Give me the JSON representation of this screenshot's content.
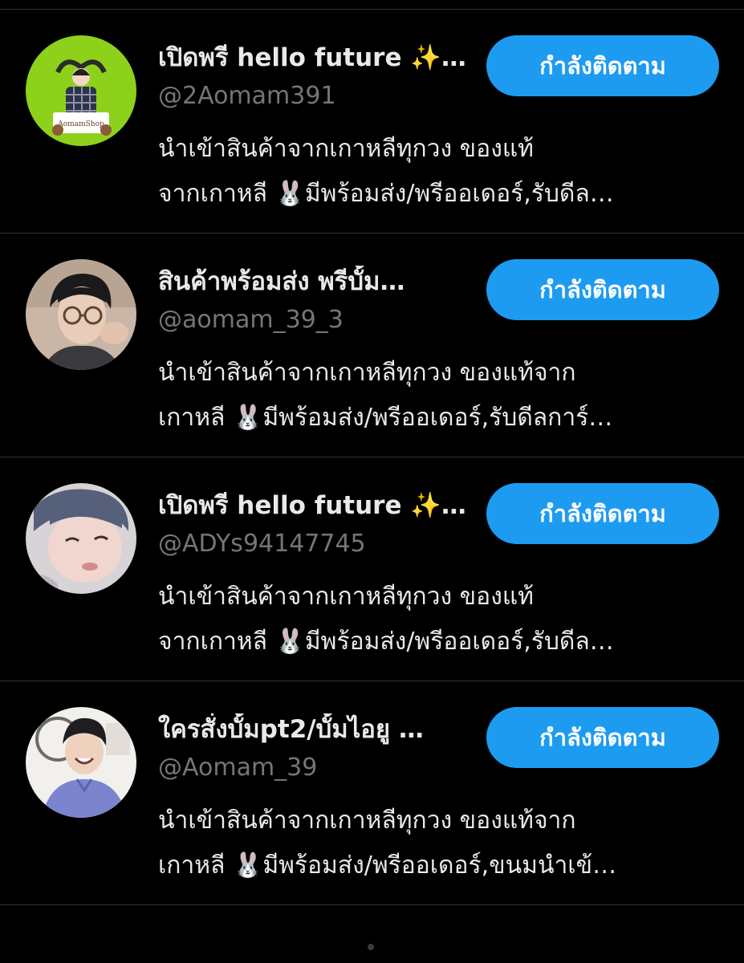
{
  "accounts": [
    {
      "name": "เปิดพรี hello future ✨…",
      "handle": "@2Aomam391",
      "bio": [
        "นำเข้าสินค้าจากเกาหลีทุกวง ของแท้",
        "จากเกาหลี 🐰มีพร้อมส่ง/พรีออเดอร์,รับดีล…"
      ],
      "button_label": "กำลังติดตาม",
      "avatar_icon": "shop-logo-avatar",
      "avatar_logo_text": "AomamShop"
    },
    {
      "name": "สินค้าพร้อมส่ง พรีบั้ม…",
      "handle": "@aomam_39_3",
      "bio": [
        "นำเข้าสินค้าจากเกาหลีทุกวง ของแท้จาก",
        "เกาหลี 🐰มีพร้อมส่ง/พรีออเดอร์,รับดีลการ์…"
      ],
      "button_label": "กำลังติดตาม",
      "avatar_icon": "person-photo-avatar"
    },
    {
      "name": "เปิดพรี hello future ✨…",
      "handle": "@ADYs94147745",
      "bio": [
        "นำเข้าสินค้าจากเกาหลีทุกวง ของแท้",
        "จากเกาหลี 🐰มีพร้อมส่ง/พรีออเดอร์,รับดีล…"
      ],
      "button_label": "กำลังติดตาม",
      "avatar_icon": "person-photo-avatar"
    },
    {
      "name": "ใครสั่งบั้มpt2/บั้มไอยู …",
      "handle": "@Aomam_39",
      "bio": [
        "นำเข้าสินค้าจากเกาหลีทุกวง ของแท้จาก",
        "เกาหลี 🐰มีพร้อมส่ง/พรีออเดอร์,ขนมนำเข้…"
      ],
      "button_label": "กำลังติดตาม",
      "avatar_icon": "person-photo-avatar"
    }
  ],
  "colors": {
    "background": "#000000",
    "button": "#1d9bf0",
    "handle": "#71767b",
    "divider": "#2f3336"
  }
}
